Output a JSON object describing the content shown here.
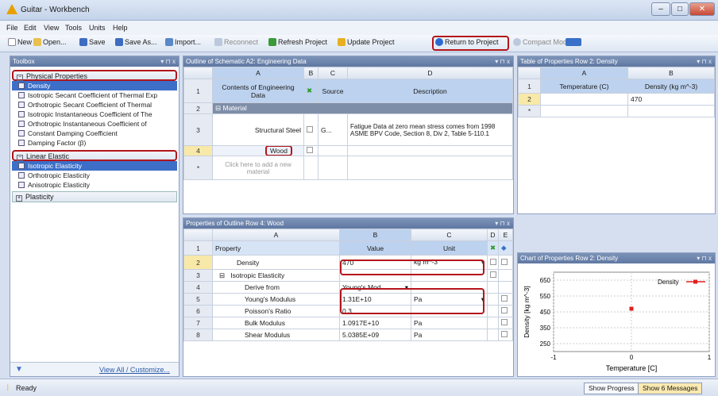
{
  "window": {
    "title": "Guitar - Workbench",
    "minimize": "–",
    "maximize": "□",
    "close": "✕"
  },
  "menu": [
    "File",
    "Edit",
    "View",
    "Tools",
    "Units",
    "Help"
  ],
  "toolbar": {
    "new": "New",
    "open": "Open...",
    "save": "Save",
    "save_as": "Save As...",
    "import": "Import...",
    "reconnect": "Reconnect",
    "refresh": "Refresh Project",
    "update": "Update Project",
    "return": "Return to Project",
    "compact": "Compact Mode"
  },
  "toolbox": {
    "title": "Toolbox",
    "pin": "▾ ⊓ x",
    "group1": "Physical Properties",
    "group1_items": [
      "Density",
      "Isotropic Secant Coefficient of Thermal Exp",
      "Orthotropic Secant Coefficient of Thermal",
      "Isotropic Instantaneous Coefficient of The",
      "Orthotropic Instantaneous Coefficient of",
      "Constant Damping Coefficient",
      "Damping Factor (β)"
    ],
    "group2": "Linear Elastic",
    "group2_items": [
      "Isotropic Elasticity",
      "Orthotropic Elasticity",
      "Anisotropic Elasticity"
    ],
    "group3": "Plasticity",
    "view_all": "View All / Customize..."
  },
  "outline": {
    "title": "Outline of Schematic A2: Engineering Data",
    "pin": "▾ ⊓ x",
    "cols": [
      "A",
      "B",
      "C",
      "D"
    ],
    "h_contents": "Contents of Engineering Data",
    "h_source": "Source",
    "h_desc": "Description",
    "row2": "Material",
    "row3_name": "Structural Steel",
    "row3_src": "G...",
    "row3_desc": "Fatigue Data at zero mean stress comes from 1998 ASME BPV Code, Section 8, Div 2, Table 5-110.1",
    "row4_name": "Wood",
    "row_new": "Click here to add a new material",
    "rownums": [
      "1",
      "2",
      "3",
      "4",
      "*"
    ]
  },
  "props": {
    "title": "Properties of Outline Row 4: Wood",
    "pin": "▾ ⊓ x",
    "cols": [
      "A",
      "B",
      "C",
      "D",
      "E"
    ],
    "h_prop": "Property",
    "h_val": "Value",
    "h_unit": "Unit",
    "rows": [
      [
        "1",
        "Property",
        "Value",
        "Unit"
      ],
      [
        "2",
        "Density",
        "470",
        "kg m^-3"
      ],
      [
        "3",
        "Isotropic Elasticity",
        "",
        ""
      ],
      [
        "4",
        "Derive from",
        "Young's Mod...",
        ""
      ],
      [
        "5",
        "Young's Modulus",
        "1.31E+10",
        "Pa"
      ],
      [
        "6",
        "Poisson's Ratio",
        "0.3",
        ""
      ],
      [
        "7",
        "Bulk Modulus",
        "1.0917E+10",
        "Pa"
      ],
      [
        "8",
        "Shear Modulus",
        "5.0385E+09",
        "Pa"
      ]
    ]
  },
  "table": {
    "title": "Table of Properties Row 2: Density",
    "pin": "▾ ⊓ x",
    "cols": [
      "A",
      "B"
    ],
    "h_temp": "Temperature (C)",
    "h_dens": "Density (kg m^-3)",
    "rownums": [
      "1",
      "2",
      "*"
    ],
    "density": "470"
  },
  "chart": {
    "title": "Chart of Properties Row 2: Density",
    "pin": "▾ ⊓ x",
    "legend": "Density",
    "ylabel": "Density [kg m^-3]",
    "xlabel": "Temperature [C]",
    "yticks": [
      "650",
      "550",
      "450",
      "350",
      "250"
    ],
    "xticks": [
      "-1",
      "0",
      "1"
    ]
  },
  "chart_data": {
    "type": "scatter",
    "title": "Chart of Properties Row 2: Density",
    "xlabel": "Temperature [C]",
    "ylabel": "Density [kg m^-3]",
    "x": [
      0
    ],
    "y": [
      470
    ],
    "xlim": [
      -1,
      1
    ],
    "ylim": [
      200,
      700
    ],
    "series": [
      {
        "name": "Density",
        "x": [
          0
        ],
        "y": [
          470
        ]
      }
    ],
    "color": "#e02020"
  },
  "status": {
    "text": "Ready",
    "progress": "Show Progress",
    "messages": "Show 6 Messages"
  }
}
